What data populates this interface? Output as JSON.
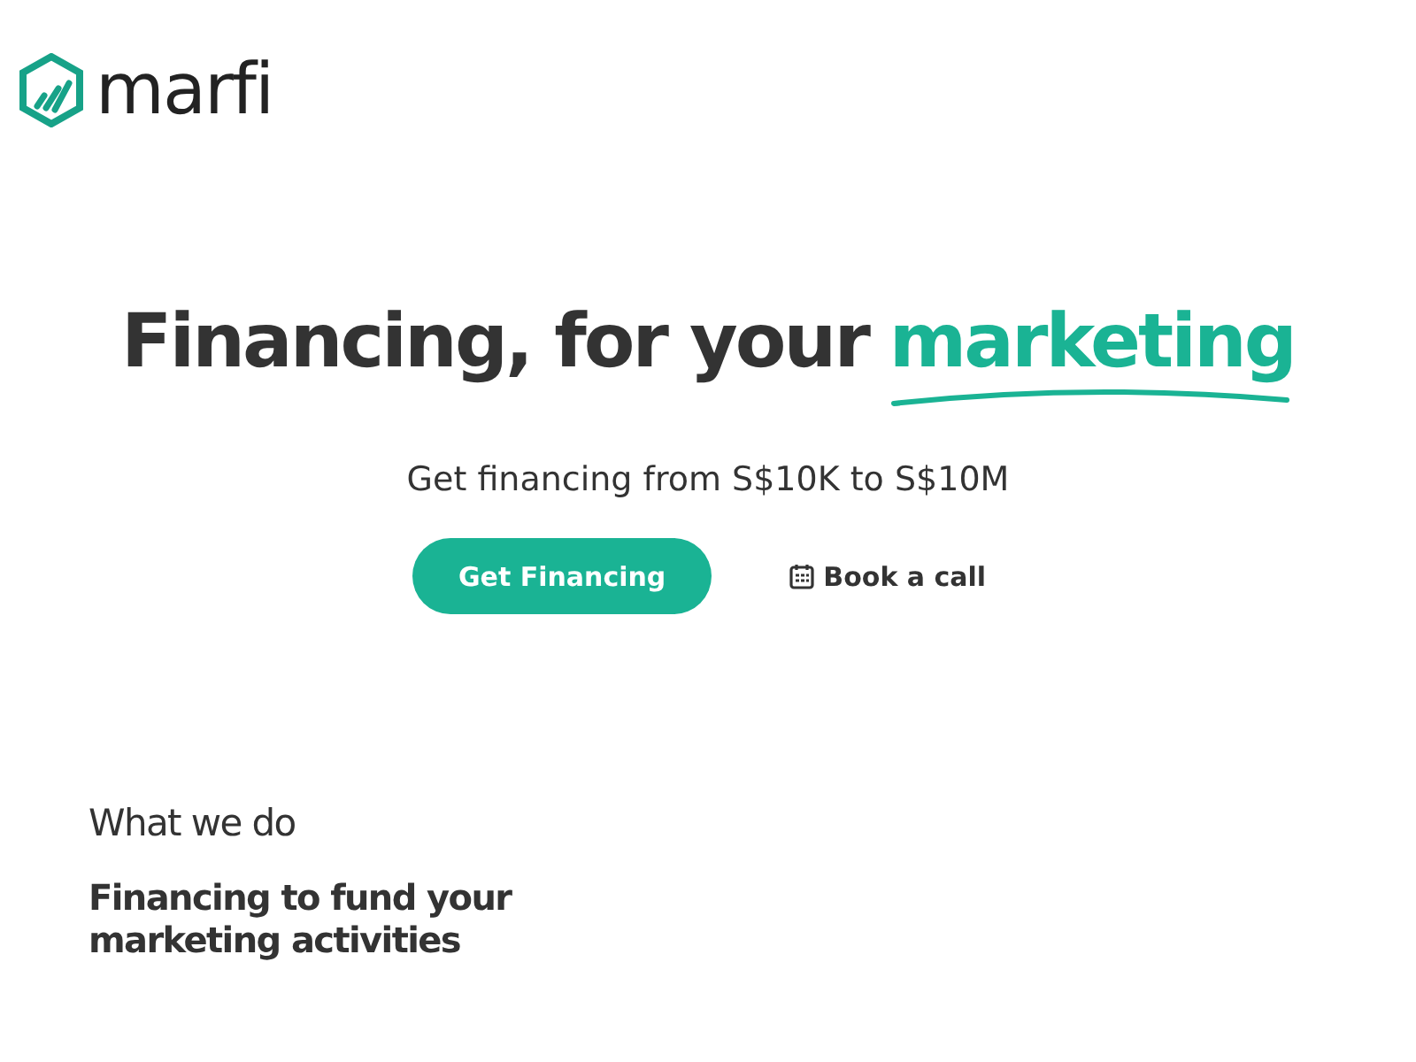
{
  "logo": {
    "name": "marfi"
  },
  "hero": {
    "title": "Financing, for your",
    "highlight": "marketing",
    "subtitle": "Get financing from S$10K to S$10M",
    "buttons": [
      {
        "kind": "primary",
        "label": "Get Financing"
      },
      {
        "kind": "calendar-link",
        "label": "Book a call"
      }
    ]
  },
  "section": {
    "eyebrow": "What we do",
    "heading": "Financing to fund your marketing activities"
  }
}
